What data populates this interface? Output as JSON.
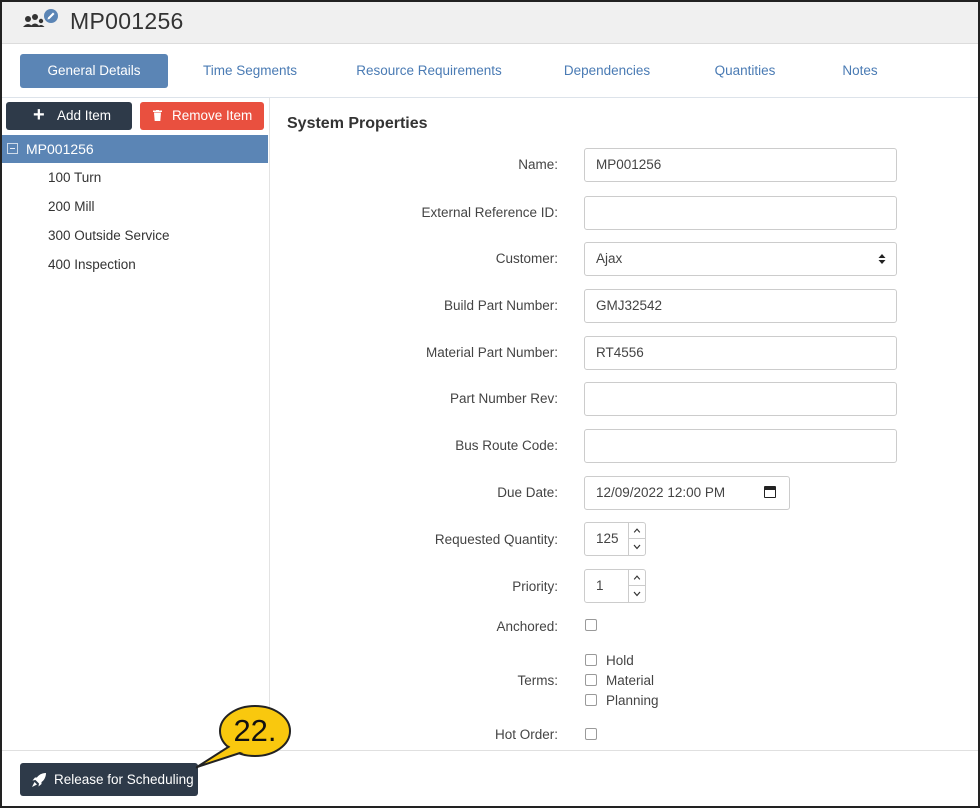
{
  "header": {
    "title": "MP001256",
    "icon": "users-edit-icon"
  },
  "tabs": [
    {
      "label": "General Details",
      "active": true
    },
    {
      "label": "Time Segments",
      "active": false
    },
    {
      "label": "Resource Requirements",
      "active": false
    },
    {
      "label": "Dependencies",
      "active": false
    },
    {
      "label": "Quantities",
      "active": false
    },
    {
      "label": "Notes",
      "active": false
    }
  ],
  "sidebar": {
    "add_label": "Add Item",
    "remove_label": "Remove Item",
    "root": {
      "label": "MP001256"
    },
    "items": [
      {
        "label": "100 Turn"
      },
      {
        "label": "200 Mill"
      },
      {
        "label": "300 Outside Service"
      },
      {
        "label": "400 Inspection"
      }
    ]
  },
  "form": {
    "section_title": "System Properties",
    "name": {
      "label": "Name:",
      "value": "MP001256"
    },
    "external_ref": {
      "label": "External Reference ID:",
      "value": ""
    },
    "customer": {
      "label": "Customer:",
      "value": "Ajax"
    },
    "build_part": {
      "label": "Build Part Number:",
      "value": "GMJ32542"
    },
    "material_part": {
      "label": "Material Part Number:",
      "value": "RT4556"
    },
    "part_rev": {
      "label": "Part Number Rev:",
      "value": ""
    },
    "bus_route": {
      "label": "Bus Route Code:",
      "value": ""
    },
    "due_date": {
      "label": "Due Date:",
      "value": "12/09/2022 12:00 PM"
    },
    "requested_qty": {
      "label": "Requested Quantity:",
      "value": "125"
    },
    "priority": {
      "label": "Priority:",
      "value": "1"
    },
    "anchored": {
      "label": "Anchored:",
      "checked": false
    },
    "terms": {
      "label": "Terms:",
      "options": [
        {
          "label": "Hold",
          "checked": false
        },
        {
          "label": "Material",
          "checked": false
        },
        {
          "label": "Planning",
          "checked": false
        }
      ]
    },
    "hot_order": {
      "label": "Hot Order:",
      "checked": false
    }
  },
  "footer": {
    "release_label": "Release for Scheduling"
  },
  "callout": {
    "step": "22.",
    "color": "#f9c80e"
  },
  "colors": {
    "tab_active": "#5b85b5",
    "tab_text": "#4a7bb4",
    "dark_button": "#2e3a49",
    "danger_button": "#e9503f"
  }
}
